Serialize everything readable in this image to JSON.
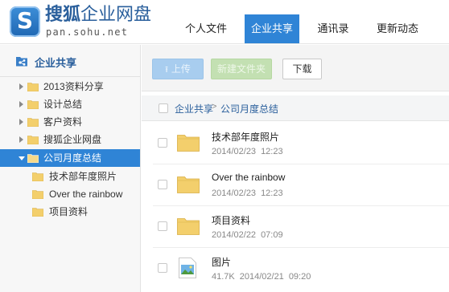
{
  "brand": {
    "logo_letter": "S",
    "title_part1": "搜狐",
    "title_part2": "企业网盘",
    "url": "pan.sohu.net"
  },
  "nav": {
    "tabs": [
      {
        "label": "个人文件",
        "active": false
      },
      {
        "label": "企业共享",
        "active": true
      },
      {
        "label": "通讯录",
        "active": false
      },
      {
        "label": "更新动态",
        "active": false
      }
    ]
  },
  "sidebar": {
    "title": "企业共享",
    "items": [
      {
        "label": "2013资料分享",
        "level": 1,
        "expanded": false,
        "selected": false
      },
      {
        "label": "设计总结",
        "level": 1,
        "expanded": false,
        "selected": false
      },
      {
        "label": "客户资料",
        "level": 1,
        "expanded": false,
        "selected": false
      },
      {
        "label": "搜狐企业网盘",
        "level": 1,
        "expanded": false,
        "selected": false
      },
      {
        "label": "公司月度总结",
        "level": 1,
        "expanded": true,
        "selected": true
      },
      {
        "label": "技术部年度照片",
        "level": 2,
        "selected": false
      },
      {
        "label": "Over the rainbow",
        "level": 2,
        "selected": false
      },
      {
        "label": "项目资料",
        "level": 2,
        "selected": false
      }
    ]
  },
  "toolbar": {
    "upload_label": "上传",
    "new_folder_label": "新建文件夹",
    "download_label": "下载"
  },
  "breadcrumb": {
    "root": "企业共享",
    "separator": ">",
    "current": "公司月度总结"
  },
  "files": [
    {
      "name": "技术部年度照片",
      "type": "folder",
      "size": "",
      "date": "2014/02/23",
      "time": "12:23"
    },
    {
      "name": "Over the rainbow",
      "type": "folder",
      "size": "",
      "date": "2014/02/23",
      "time": "12:23"
    },
    {
      "name": "项目资料",
      "type": "folder",
      "size": "",
      "date": "2014/02/22",
      "time": "07:09"
    },
    {
      "name": "图片",
      "type": "image",
      "size": "41.7K",
      "date": "2014/02/21",
      "time": "09:20"
    }
  ],
  "colors": {
    "accent": "#2f84d6",
    "brand_text": "#2a5f9c",
    "upload_button": "#a8cdef",
    "new_folder_button": "#c3e0b2",
    "folder": "#f3cf6c"
  },
  "icons": {
    "logo": "sohu-s-logo-icon",
    "sidebar_header": "share-folder-icon",
    "upload": "upload-arrow-icon",
    "folder": "folder-icon",
    "image_file": "image-file-icon"
  }
}
